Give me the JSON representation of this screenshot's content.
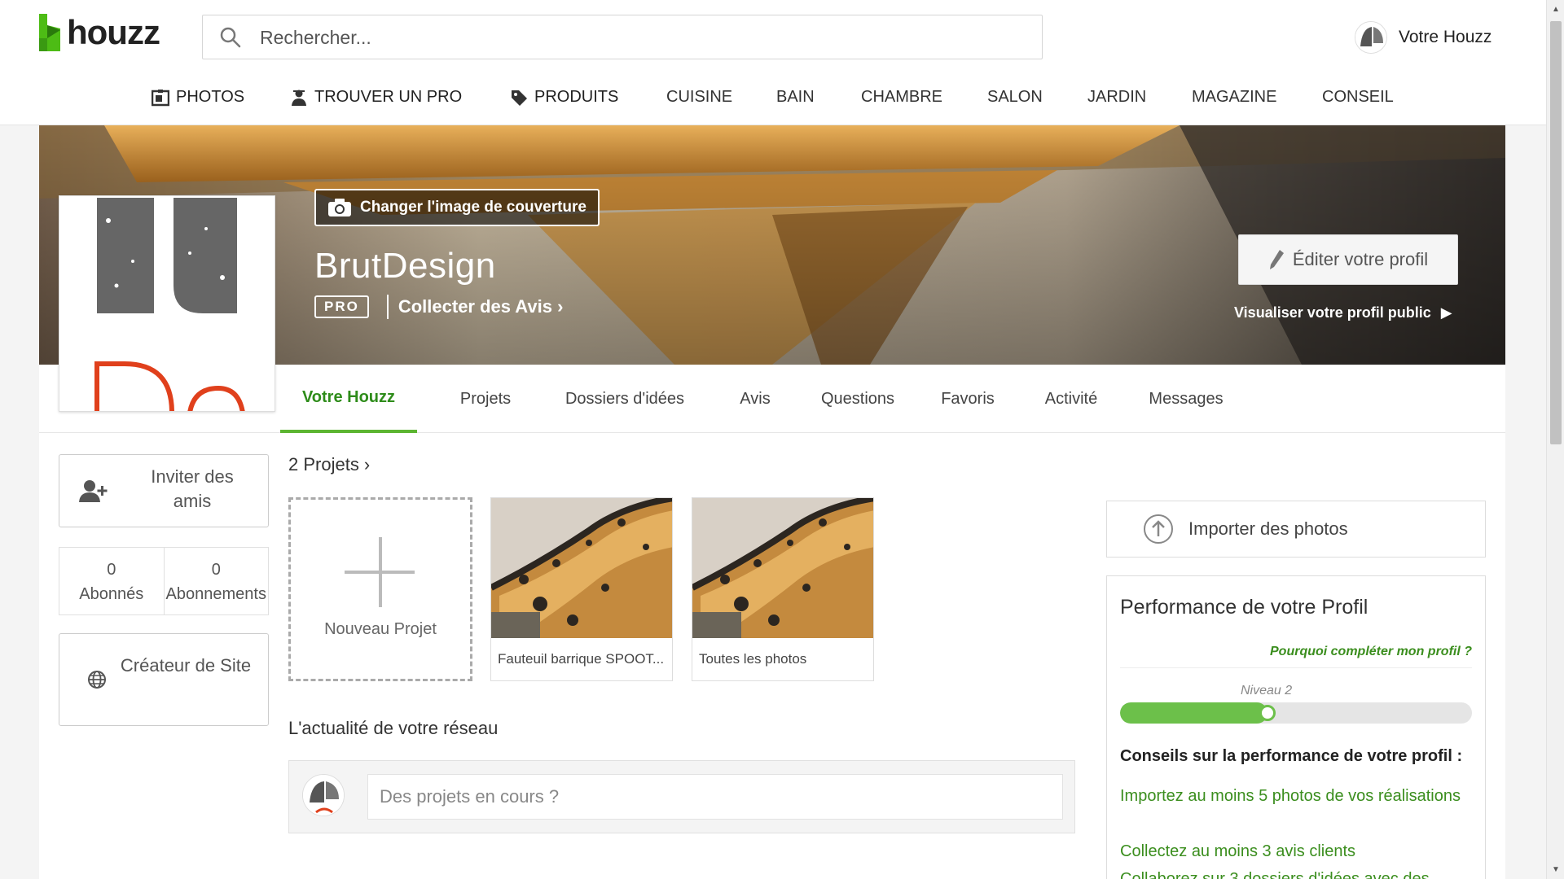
{
  "header": {
    "logo_text": "houzz",
    "search_placeholder": "Rechercher...",
    "user_label": "Votre Houzz"
  },
  "nav": {
    "items": [
      {
        "label": "PHOTOS",
        "icon": "photos-icon"
      },
      {
        "label": "TROUVER UN PRO",
        "icon": "pro-icon"
      },
      {
        "label": "PRODUITS",
        "icon": "tag-icon"
      },
      {
        "label": "CUISINE"
      },
      {
        "label": "BAIN"
      },
      {
        "label": "CHAMBRE"
      },
      {
        "label": "SALON"
      },
      {
        "label": "JARDIN"
      },
      {
        "label": "MAGAZINE"
      },
      {
        "label": "CONSEIL"
      }
    ]
  },
  "profile": {
    "change_cover_label": "Changer l'image de couverture",
    "name": "BrutDesign",
    "pro_badge": "PRO",
    "collect_reviews": "Collecter des Avis",
    "edit_profile": "Éditer votre profil",
    "view_public": "Visualiser votre profil public"
  },
  "tabs": [
    {
      "label": "Votre Houzz",
      "active": true
    },
    {
      "label": "Projets"
    },
    {
      "label": "Dossiers d'idées"
    },
    {
      "label": "Avis"
    },
    {
      "label": "Questions"
    },
    {
      "label": "Favoris"
    },
    {
      "label": "Activité"
    },
    {
      "label": "Messages"
    }
  ],
  "sidebar": {
    "invite_label": "Inviter des amis",
    "followers_count": "0",
    "followers_label": "Abonnés",
    "following_count": "0",
    "following_label": "Abonnements",
    "site_creator_label": "Créateur de Site"
  },
  "projects": {
    "title": "2 Projets",
    "new_project_label": "Nouveau Projet",
    "items": [
      {
        "label": "Fauteuil barrique SPOOT..."
      },
      {
        "label": "Toutes les photos"
      }
    ]
  },
  "feed": {
    "title": "L'actualité de votre réseau",
    "placeholder": "Des projets en cours ?"
  },
  "right": {
    "import_label": "Importer des photos",
    "perf_title": "Performance de votre Profil",
    "why_link": "Pourquoi compléter mon profil ?",
    "level_label": "Niveau 2",
    "progress": 0.42,
    "tips_title": "Conseils sur la performance de votre profil :",
    "tips": [
      "Importez au moins 5 photos de vos réalisations",
      "Collectez au moins 3 avis clients",
      "Collaborez sur 3 dossiers d'idées avec des"
    ]
  },
  "colors": {
    "brand_green": "#5cb531",
    "link_green": "#3b8e1e",
    "progress_green": "#6cc04a"
  }
}
